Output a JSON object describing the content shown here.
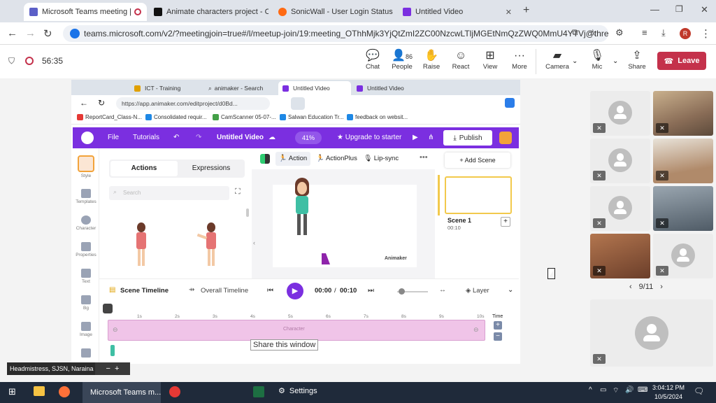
{
  "browser": {
    "tabs": [
      {
        "title": "Microsoft Teams meeting |",
        "active": true
      },
      {
        "title": "Animate characters project - Ca"
      },
      {
        "title": "SonicWall - User Login Status"
      },
      {
        "title": "Untitled Video"
      }
    ],
    "url": "teams.microsoft.com/v2/?meetingjoin=true#/l/meetup-join/19:meeting_OThhMjk3YjQtZmI2ZC00NzcwLTljMGEtNmQzZWQ0MmU4YTVj@thread.v2/...",
    "profile_initial": "R"
  },
  "meeting": {
    "timer": "56:35",
    "toolbar": [
      {
        "label": "Chat",
        "icon": "chat-icon"
      },
      {
        "label": "People",
        "count": "86",
        "icon": "people-icon"
      },
      {
        "label": "Raise",
        "icon": "hand-icon"
      },
      {
        "label": "React",
        "icon": "smile-icon"
      },
      {
        "label": "View",
        "icon": "grid-icon"
      },
      {
        "label": "More",
        "icon": "more-icon"
      },
      {
        "label": "Camera",
        "icon": "camera-off-icon"
      },
      {
        "label": "Mic",
        "icon": "mic-off-icon"
      },
      {
        "label": "Share",
        "icon": "share-icon"
      }
    ],
    "leave_label": "Leave",
    "pagination": "9/11",
    "presenter_label": "Headmistress, SJSN, Naraina"
  },
  "inner_browser": {
    "tabs": [
      {
        "title": "ICT - Training"
      },
      {
        "title": "animaker - Search"
      },
      {
        "title": "Untitled Video",
        "active": true
      },
      {
        "title": "Untitled Video"
      }
    ],
    "url": "https://app.animaker.com/editproject/d0Bd...",
    "bookmarks": [
      "ReportCard_Class-N...",
      "Consolidated requir...",
      "CamScanner 05-07-...",
      "Salwan Education Tr...",
      "feedback on websit..."
    ]
  },
  "animaker": {
    "menu": [
      "File",
      "Tutorials"
    ],
    "project_title": "Untitled Video",
    "zoom": "41%",
    "upgrade": "Upgrade to starter",
    "publish": "Publish",
    "left_nav": [
      "Style",
      "Templates",
      "Character",
      "Properties",
      "Text",
      "Bg",
      "Image",
      "Video"
    ],
    "panel_tabs": [
      "Actions",
      "Expressions"
    ],
    "search_placeholder": "Search",
    "char_tabs": [
      "Action",
      "ActionPlus",
      "Lip-sync"
    ],
    "add_scene": "+ Add Scene",
    "scene_name": "Scene 1",
    "scene_time": "00:10",
    "watermark": "Animaker",
    "timeline": {
      "scene_timeline": "Scene Timeline",
      "overall_timeline": "Overall Timeline",
      "time_current": "00:00",
      "time_sep": "/",
      "time_total": "00:10",
      "layer": "Layer",
      "ticks": [
        "1s",
        "2s",
        "3s",
        "4s",
        "5s",
        "6s",
        "7s",
        "8s",
        "9s",
        "10s"
      ],
      "time_label": "Time",
      "track_label": "Character",
      "tooltip": "Share this window"
    }
  },
  "taskbar": {
    "teams_app": "Microsoft Teams m...",
    "settings": "Settings",
    "time": "3:04:12 PM",
    "date": "10/5/2024"
  },
  "colors": {
    "animaker_purple": "#7b2fe0",
    "leave_red": "#c4314b",
    "scene_yellow": "#f2c94c",
    "track_pink": "#f0c4e8"
  }
}
